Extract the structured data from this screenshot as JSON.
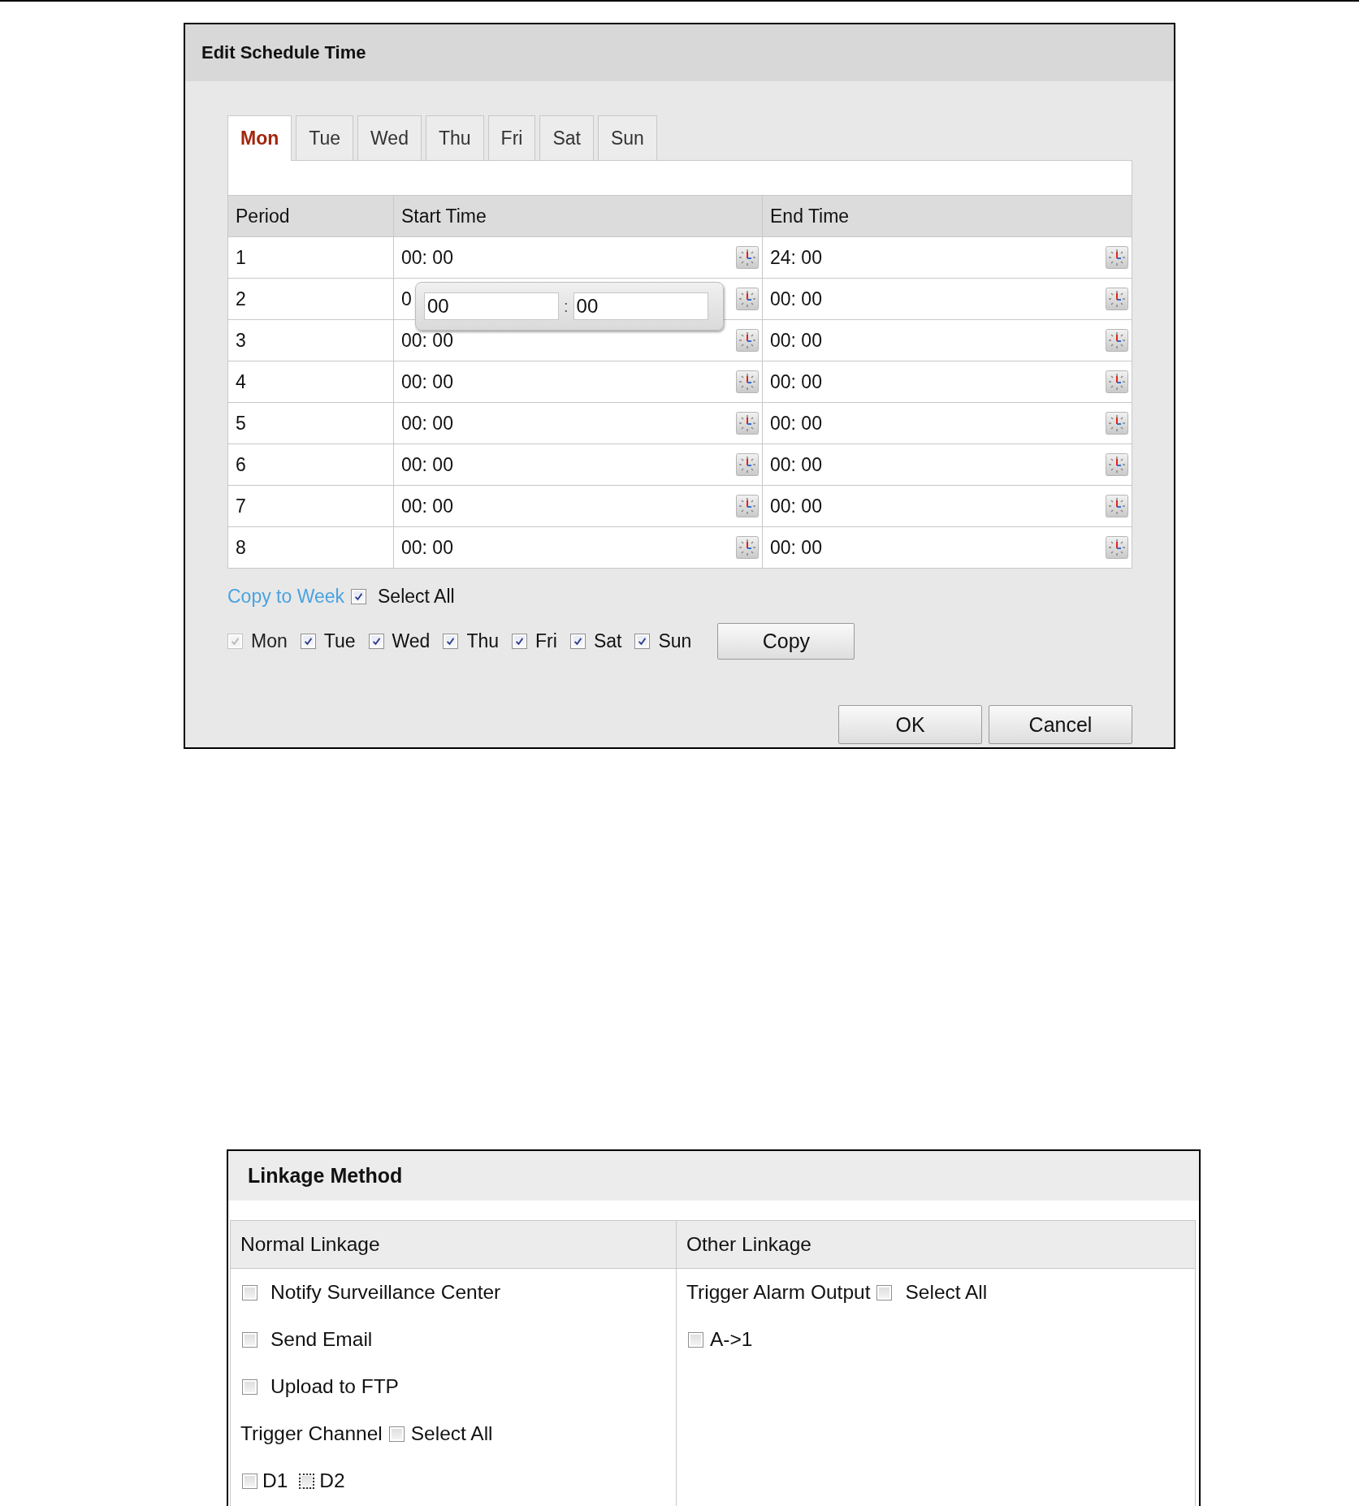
{
  "schedule_dialog": {
    "title": "Edit Schedule Time",
    "tabs": [
      {
        "label": "Mon",
        "selected": true
      },
      {
        "label": "Tue",
        "selected": false
      },
      {
        "label": "Wed",
        "selected": false
      },
      {
        "label": "Thu",
        "selected": false
      },
      {
        "label": "Fri",
        "selected": false
      },
      {
        "label": "Sat",
        "selected": false
      },
      {
        "label": "Sun",
        "selected": false
      }
    ],
    "table": {
      "columns": [
        "Period",
        "Start Time",
        "End Time"
      ],
      "rows": [
        {
          "period": "1",
          "start": "00: 00",
          "end": "24: 00"
        },
        {
          "period": "2",
          "start": "0",
          "end": "00: 00",
          "start_popup": {
            "hour": "00",
            "separator": ":",
            "minute": "00"
          }
        },
        {
          "period": "3",
          "start": "00: 00",
          "end": "00: 00"
        },
        {
          "period": "4",
          "start": "00: 00",
          "end": "00: 00"
        },
        {
          "period": "5",
          "start": "00: 00",
          "end": "00: 00"
        },
        {
          "period": "6",
          "start": "00: 00",
          "end": "00: 00"
        },
        {
          "period": "7",
          "start": "00: 00",
          "end": "00: 00"
        },
        {
          "period": "8",
          "start": "00: 00",
          "end": "00: 00"
        }
      ]
    },
    "copy_to_week": {
      "link": "Copy to Week",
      "select_all": {
        "label": "Select All",
        "checked": true
      },
      "days": [
        {
          "label": "Mon",
          "checked": true,
          "disabled": true
        },
        {
          "label": "Tue",
          "checked": true,
          "disabled": false
        },
        {
          "label": "Wed",
          "checked": true,
          "disabled": false
        },
        {
          "label": "Thu",
          "checked": true,
          "disabled": false
        },
        {
          "label": "Fri",
          "checked": true,
          "disabled": false
        },
        {
          "label": "Sat",
          "checked": true,
          "disabled": false
        },
        {
          "label": "Sun",
          "checked": true,
          "disabled": false
        }
      ],
      "copy_button": "Copy"
    },
    "buttons": [
      "OK",
      "Cancel"
    ]
  },
  "linkage_method": {
    "title": "Linkage Method",
    "normal_linkage": {
      "heading": "Normal Linkage",
      "options": [
        {
          "label": "Notify Surveillance Center",
          "checked": false
        },
        {
          "label": "Send Email",
          "checked": false
        },
        {
          "label": "Upload to FTP",
          "checked": false
        }
      ],
      "trigger_channel": {
        "label": "Trigger Channel",
        "select_all": {
          "label": "Select All",
          "checked": false
        },
        "channels": [
          {
            "label": "D1",
            "checked": false,
            "focused": false
          },
          {
            "label": "D2",
            "checked": false,
            "focused": true
          }
        ]
      }
    },
    "other_linkage": {
      "heading": "Other Linkage",
      "trigger_alarm_output": {
        "label": "Trigger Alarm Output",
        "select_all": {
          "label": "Select All",
          "checked": false
        },
        "outputs": [
          {
            "label": "A->1",
            "checked": false
          }
        ]
      }
    }
  }
}
